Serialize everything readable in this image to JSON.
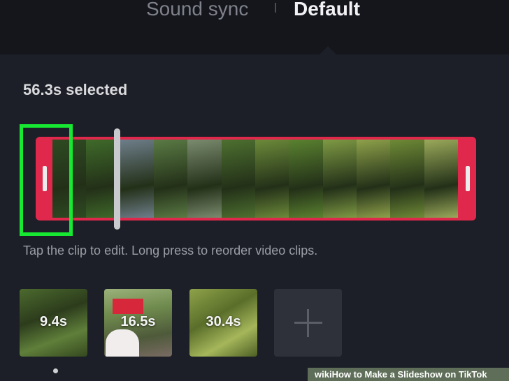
{
  "tabs": [
    {
      "label": "Sound sync"
    },
    {
      "label": "Default"
    }
  ],
  "selection": {
    "text": "56.3s selected"
  },
  "timeline": {
    "accent_color": "#e0284d",
    "highlight_color": "#17e832",
    "frames": [
      "#2e4a22",
      "#3f6a2a",
      "#6e7e8a",
      "#5a7a44",
      "#7a8b6e",
      "#4d7030",
      "#6c8a3a",
      "#5a8230",
      "#7e9a44",
      "#8ea14a",
      "#6e8a36",
      "#9aa95a"
    ]
  },
  "hint": {
    "text": "Tap the clip to edit. Long press to reorder video clips."
  },
  "clips": [
    {
      "duration": "9.4s"
    },
    {
      "duration": "16.5s"
    },
    {
      "duration": "30.4s"
    }
  ],
  "watermark": {
    "brand": "wiki",
    "title": "How to Make a Slideshow on TikTok"
  }
}
